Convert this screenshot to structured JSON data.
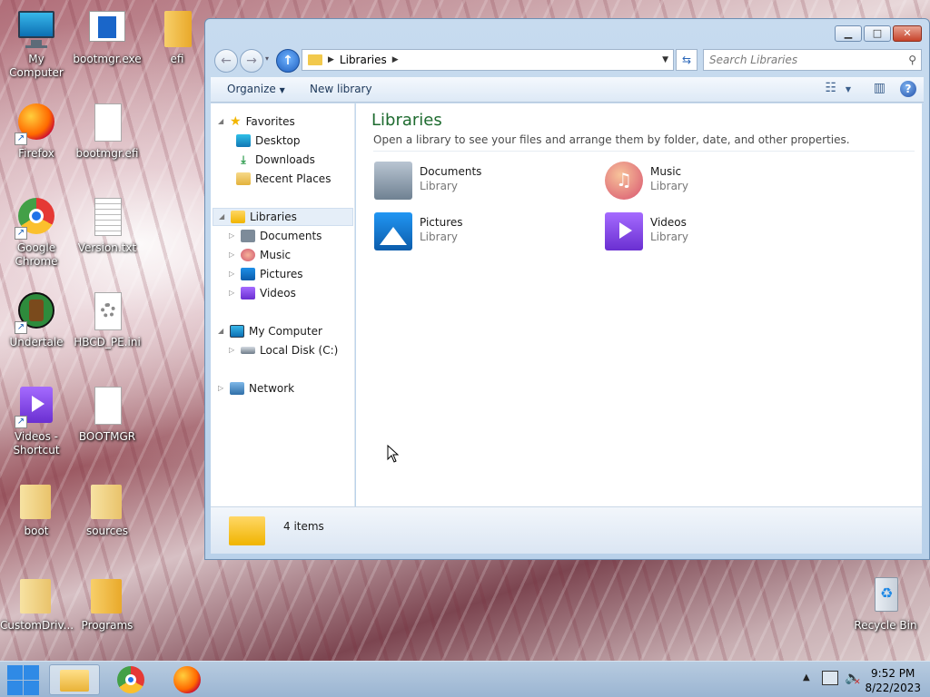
{
  "desktop": {
    "icons": [
      {
        "label": "My Computer"
      },
      {
        "label": "bootmgr.exe"
      },
      {
        "label": "efi"
      },
      {
        "label": "Firefox"
      },
      {
        "label": "bootmgr.efi"
      },
      {
        "label": "Google Chrome"
      },
      {
        "label": "Version.txt"
      },
      {
        "label": "Undertale"
      },
      {
        "label": "HBCD_PE.ini"
      },
      {
        "label": "Videos - Shortcut"
      },
      {
        "label": "BOOTMGR"
      },
      {
        "label": "boot"
      },
      {
        "label": "sources"
      },
      {
        "label": "CustomDriv..."
      },
      {
        "label": "Programs"
      },
      {
        "label": "Recycle Bin"
      }
    ]
  },
  "window": {
    "address": "Libraries",
    "search_placeholder": "Search Libraries",
    "toolbar": {
      "organize": "Organize",
      "new_library": "New library"
    },
    "nav": {
      "favorites": "Favorites",
      "desktop": "Desktop",
      "downloads": "Downloads",
      "recent": "Recent Places",
      "libraries": "Libraries",
      "documents": "Documents",
      "music": "Music",
      "pictures": "Pictures",
      "videos": "Videos",
      "computer": "My Computer",
      "localdisk": "Local Disk (C:)",
      "network": "Network"
    },
    "content": {
      "title": "Libraries",
      "description": "Open a library to see your files and arrange them by folder, date, and other properties.",
      "libraries": [
        {
          "name": "Documents",
          "type": "Library"
        },
        {
          "name": "Music",
          "type": "Library"
        },
        {
          "name": "Pictures",
          "type": "Library"
        },
        {
          "name": "Videos",
          "type": "Library"
        }
      ]
    },
    "details": {
      "count": "4 items"
    }
  },
  "taskbar": {
    "time": "9:52 PM",
    "date": "8/22/2023"
  }
}
